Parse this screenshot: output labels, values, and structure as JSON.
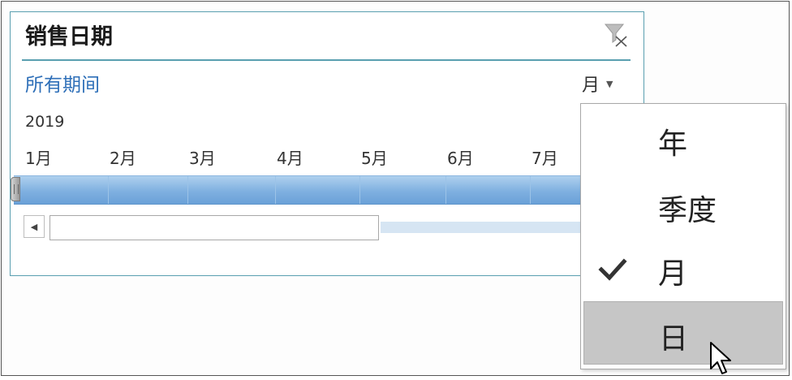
{
  "slicer": {
    "title": "销售日期",
    "period_label": "所有期间",
    "level_value": "月",
    "year": "2019",
    "months": [
      "1月",
      "2月",
      "3月",
      "4月",
      "5月",
      "6月",
      "7月"
    ]
  },
  "dropdown": {
    "options": [
      {
        "label": "年",
        "checked": false
      },
      {
        "label": "季度",
        "checked": false
      },
      {
        "label": "月",
        "checked": true
      },
      {
        "label": "日",
        "checked": false,
        "hovered": true
      }
    ]
  },
  "colors": {
    "accent": "#5a9fb0",
    "link": "#2e6fb8",
    "timeline": "#7fb0e0",
    "hover": "#c6c6c6"
  },
  "icons": {
    "clear_filter": "clear-filter-icon",
    "dropdown_arrow": "chevron-down-icon",
    "scroll_left": "scroll-left-icon",
    "check": "check-icon",
    "cursor": "mouse-pointer-icon"
  }
}
